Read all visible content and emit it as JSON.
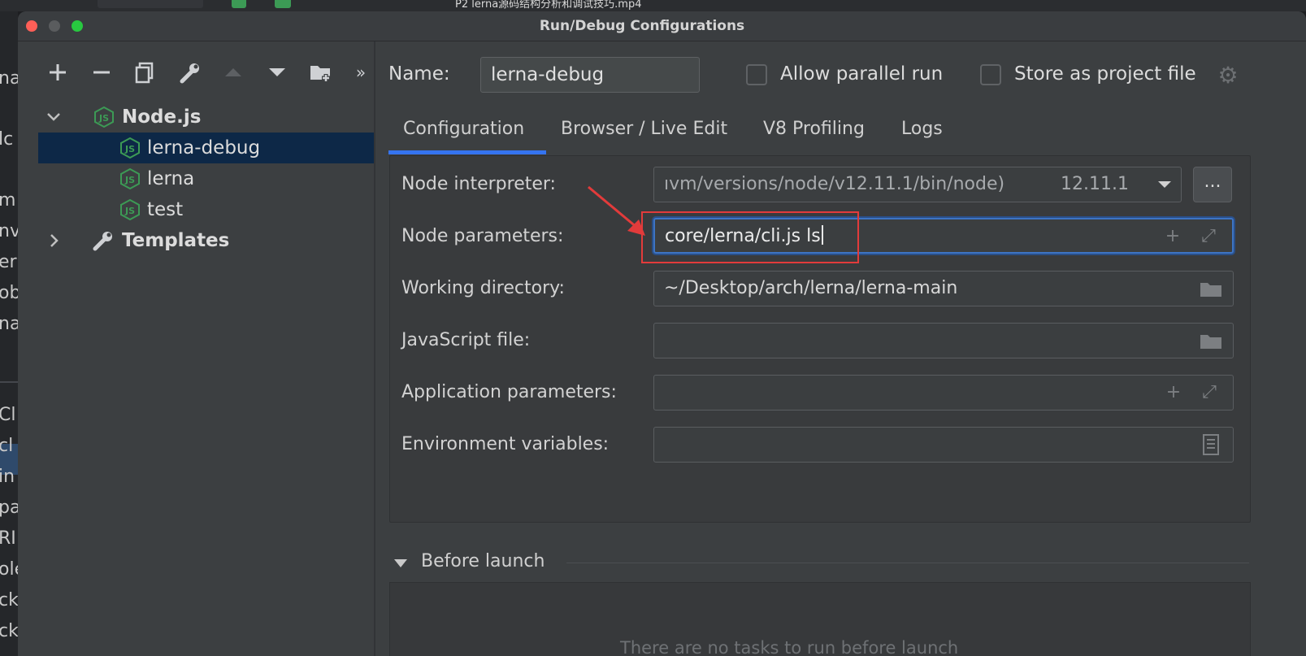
{
  "background_ide": {
    "title_fragment": "P2 lerna源码结构分析和调试技巧.mp4",
    "left_fragments": [
      "na",
      "lc",
      "m",
      "nv",
      "er",
      "ob",
      "na",
      "Cl",
      "cl",
      "in",
      "pa",
      "RI",
      "ole",
      "ck",
      "ck"
    ]
  },
  "dialog": {
    "title": "Run/Debug Configurations"
  },
  "toolbar": {
    "icons": [
      "plus-icon",
      "minus-icon",
      "copy-icon",
      "wrench-icon",
      "move-up-icon",
      "move-down-icon",
      "new-folder-icon",
      "more-icon"
    ]
  },
  "tree": {
    "node_group": "Node.js",
    "items": [
      {
        "label": "lerna-debug",
        "selected": true
      },
      {
        "label": "lerna",
        "selected": false
      },
      {
        "label": "test",
        "selected": false
      }
    ],
    "templates": "Templates"
  },
  "config": {
    "name_label": "Name:",
    "name_value": "lerna-debug",
    "allow_parallel_label": "Allow parallel run",
    "store_project_label": "Store as project file"
  },
  "tabs": [
    {
      "label": "Configuration",
      "active": true
    },
    {
      "label": "Browser / Live Edit",
      "active": false
    },
    {
      "label": "V8 Profiling",
      "active": false
    },
    {
      "label": "Logs",
      "active": false
    }
  ],
  "fields": {
    "node_interpreter": {
      "label": "Node interpreter:",
      "value": "ıvm/versions/node/v12.11.1/bin/node)",
      "version": "12.11.1",
      "more": "..."
    },
    "node_parameters": {
      "label": "Node parameters:",
      "value": "core/lerna/cli.js ls"
    },
    "working_directory": {
      "label": "Working directory:",
      "value": "~/Desktop/arch/lerna/lerna-main"
    },
    "javascript_file": {
      "label": "JavaScript file:",
      "value": ""
    },
    "application_parameters": {
      "label": "Application parameters:",
      "value": ""
    },
    "environment_variables": {
      "label": "Environment variables:",
      "value": ""
    }
  },
  "before_launch": {
    "label": "Before launch",
    "empty_text": "There are no tasks to run before launch"
  },
  "colors": {
    "accent": "#3574f0",
    "selection": "#0d2847",
    "annotation": "#e23b3b",
    "nodejs_green": "#3c9a55"
  }
}
